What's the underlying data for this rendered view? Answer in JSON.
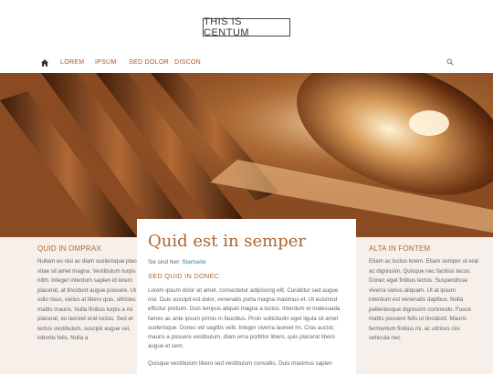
{
  "header": {
    "logo_text": "THIS IS CENTUM"
  },
  "nav": {
    "items": [
      "LOREM",
      "IPSUM",
      "SED DOLOR",
      "DISCON"
    ]
  },
  "left": {
    "title": "QUID IN OMPRAX",
    "text": "Nullam eu nisi ac diam scelerisque placerat vitae sit amet magna. Vestibulum turpis nibh. Integer interdum sapien id lorem placerat, at tincidunt augue posuere. Ut odio risus, varius at libero quis, ultricies mattis mauris. Nulla finibus turpis a mi placerat, eu laoreet erat luctus. Sed et lectus vestibulum, suscipit augue vel, lobortis felis. Nulla a"
  },
  "main": {
    "title": "Quid est in semper",
    "breadcrumb_prefix": "Sie sind hier:",
    "breadcrumb_link": "Startseite",
    "subtitle": "SED QUID IN DONEC",
    "paragraph1": "Lorem ipsum dolor sit amet, consectetur adipiscing elit. Curabitur sed augue nisi. Duis suscipit est dolor, venenatis porta magna maximus et. Ut euismod efficitur pretium. Duis tempus aliquet magna a luctus. Interdum et malesuada fames ac ante ipsum primis in faucibus. Proin sollicitudin eget ligula sit amet scelerisque. Donec vel sagittis velit. Integer viverra laoreet mi. Cras auctor, mauris a posuere vestibulum, diam urna porttitor libero, quis placerat libero augue et sem.",
    "paragraph2": "Quisque vestibulum libero sed vestibulum convallis. Duis maximus sapien"
  },
  "right": {
    "title": "ALTA IN FONTEM",
    "text": "Etiam ac luctus lorem. Etiam semper ut erat ac dignissim. Quisque nec facilisis lacus. Donec eget finibus lectus. Suspendisse viverra varius aliquam. Ut at ipsum interdum est venenatis dapibus. Nulla pellentesque dignissim commodo. Fusce mattis posuere felis ut tincidunt. Mauris fermentum finibus mi, ac ultrices nisi vehicula nec."
  },
  "colors": {
    "accent": "#b06a32",
    "link": "#3a7ea4",
    "background": "#f6efea"
  }
}
